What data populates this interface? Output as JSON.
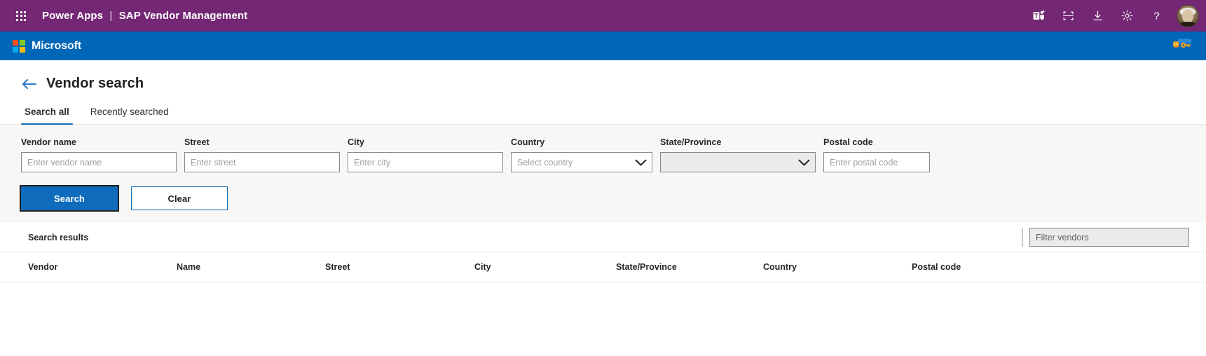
{
  "suite": {
    "waffle_icon": "waffle-grid-icon",
    "app_name": "Power Apps",
    "separator": "|",
    "environment": "SAP Vendor Management",
    "icons": [
      {
        "name": "teams-icon",
        "label": "Teams"
      },
      {
        "name": "fullscreen-icon",
        "label": "Full screen"
      },
      {
        "name": "download-icon",
        "label": "Download"
      },
      {
        "name": "gear-icon",
        "label": "Settings"
      },
      {
        "name": "help-icon",
        "label": "Help"
      }
    ],
    "avatar": {
      "name": "user-avatar",
      "label": "Account manager"
    },
    "bar_color": "#742774"
  },
  "brand_bar": {
    "logo_label": "Microsoft",
    "bar_color": "#0067b8",
    "right_icon": "database-key-icon"
  },
  "page": {
    "back_icon": "back-arrow-icon",
    "title": "Vendor search",
    "accent_color": "#0f6cbd"
  },
  "tabs": [
    {
      "label": "Search all",
      "active": true
    },
    {
      "label": "Recently searched",
      "active": false
    }
  ],
  "search_form": {
    "background": "#f8f7f6",
    "fields": [
      {
        "label": "Vendor name",
        "placeholder": "Enter vendor name",
        "value": "",
        "type": "text",
        "name": "vendor-name"
      },
      {
        "label": "Street",
        "placeholder": "Enter street",
        "value": "",
        "type": "text",
        "name": "street"
      },
      {
        "label": "City",
        "placeholder": "Enter city",
        "value": "",
        "type": "text",
        "name": "city"
      },
      {
        "label": "Country",
        "placeholder": "Select country",
        "value": "",
        "type": "select",
        "name": "country",
        "disabled": false
      },
      {
        "label": "State/Province",
        "placeholder": "",
        "value": "",
        "type": "select",
        "name": "state-province",
        "disabled": true
      },
      {
        "label": "Postal code",
        "placeholder": "Enter postal code",
        "value": "",
        "type": "text",
        "name": "postal-code"
      }
    ],
    "buttons": {
      "search_label": "Search",
      "clear_label": "Clear"
    }
  },
  "results": {
    "title": "Search results",
    "filter_placeholder": "Filter vendors",
    "filter_value": "",
    "columns": [
      "Vendor",
      "Name",
      "Street",
      "City",
      "State/Province",
      "Country",
      "Postal code"
    ],
    "rows": []
  }
}
